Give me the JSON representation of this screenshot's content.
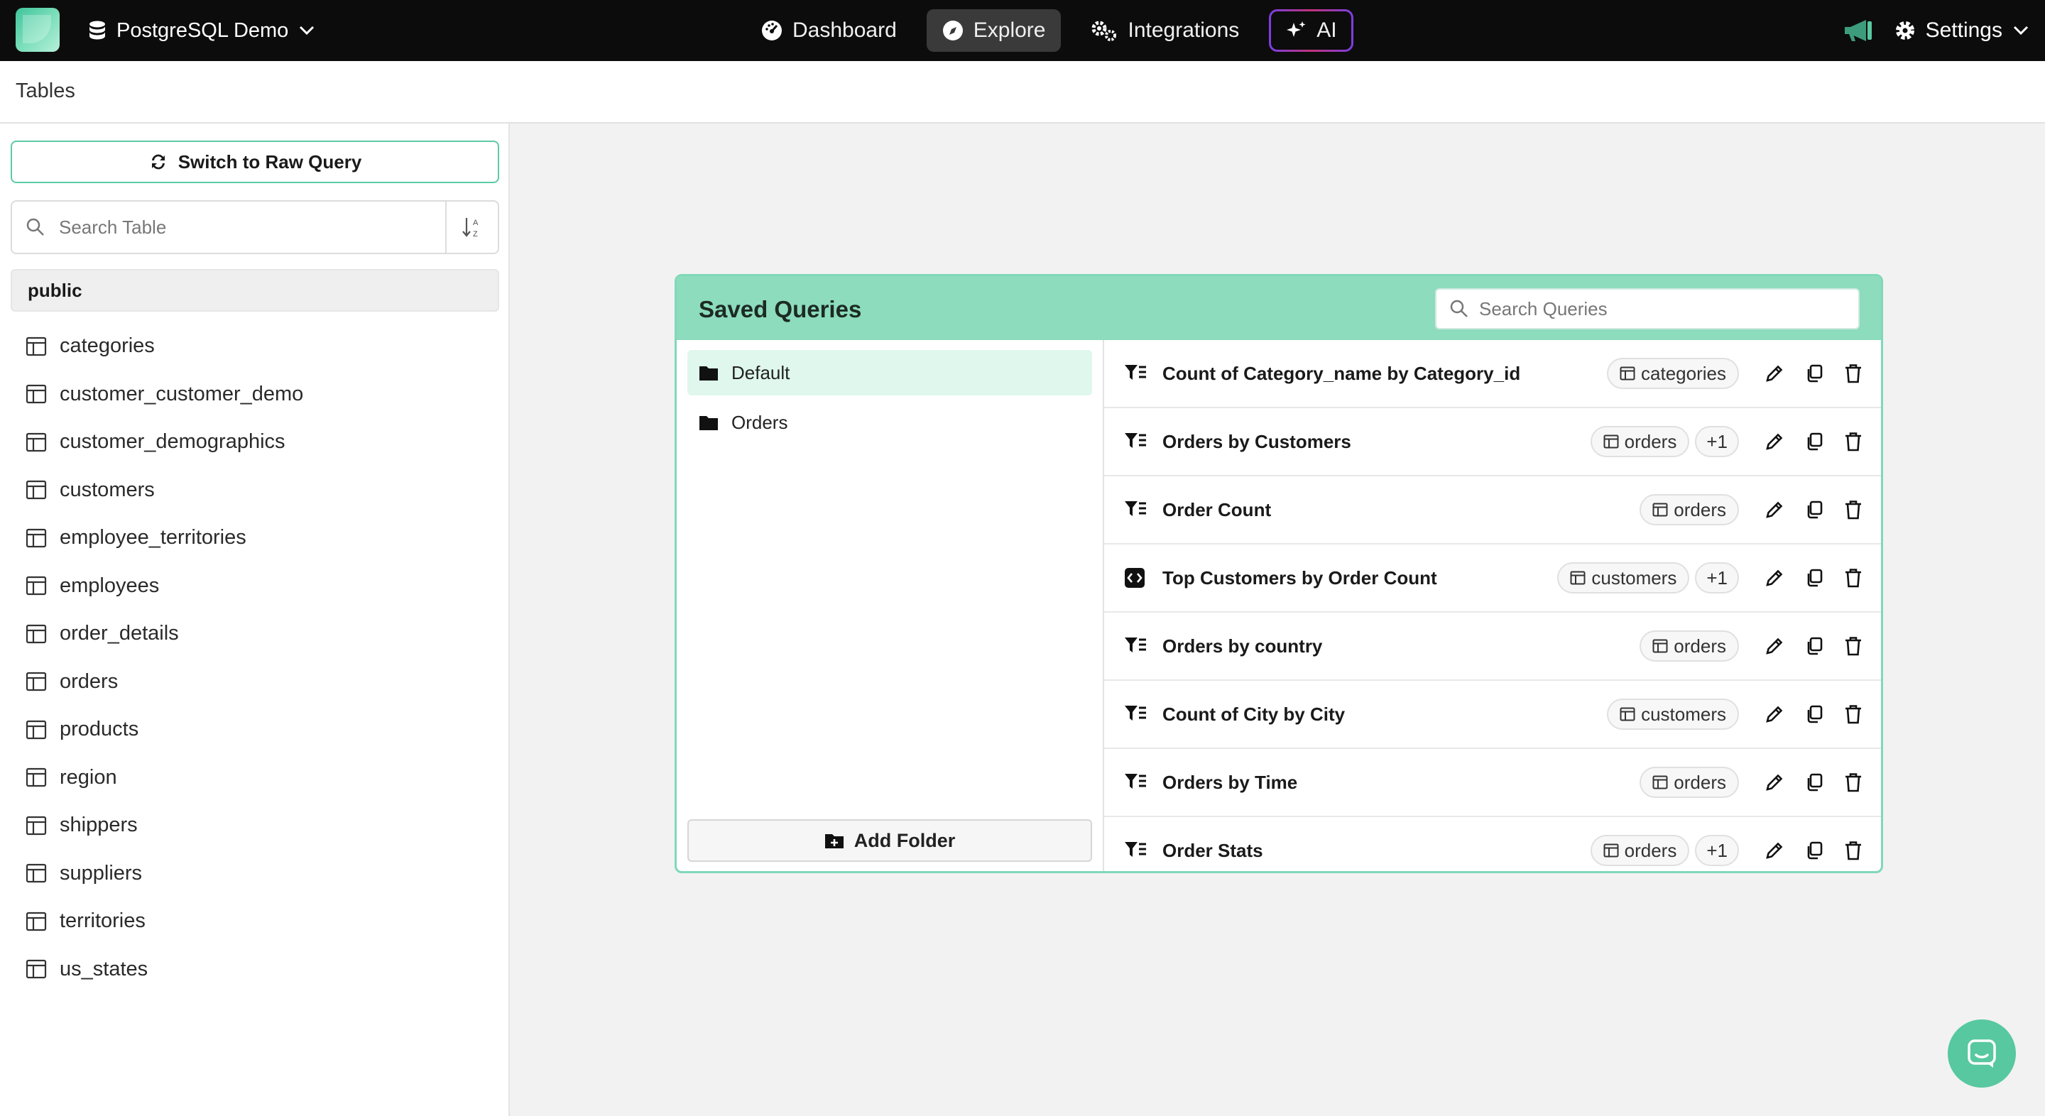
{
  "topbar": {
    "database_name": "PostgreSQL Demo",
    "nav": [
      {
        "label": "Dashboard",
        "icon": "gauge-icon",
        "active": false
      },
      {
        "label": "Explore",
        "icon": "compass-icon",
        "active": true
      },
      {
        "label": "Integrations",
        "icon": "gears-icon",
        "active": false
      },
      {
        "label": "AI",
        "icon": "sparkles-icon",
        "active": false
      }
    ],
    "settings_label": "Settings"
  },
  "subheader": {
    "title": "Tables"
  },
  "sidebar": {
    "raw_query_label": "Switch to Raw Query",
    "search_placeholder": "Search Table",
    "schema": "public",
    "tables": [
      "categories",
      "customer_customer_demo",
      "customer_demographics",
      "customers",
      "employee_territories",
      "employees",
      "order_details",
      "orders",
      "products",
      "region",
      "shippers",
      "suppliers",
      "territories",
      "us_states"
    ]
  },
  "saved_queries": {
    "title": "Saved Queries",
    "search_placeholder": "Search Queries",
    "folders": [
      {
        "name": "Default",
        "active": true
      },
      {
        "name": "Orders",
        "active": false
      }
    ],
    "add_folder_label": "Add Folder",
    "queries": [
      {
        "name": "Count of Category_name by Category_id",
        "icon": "filter-list-icon",
        "table": "categories",
        "extra": ""
      },
      {
        "name": "Orders by Customers",
        "icon": "filter-list-icon",
        "table": "orders",
        "extra": "+1"
      },
      {
        "name": "Order Count",
        "icon": "filter-list-icon",
        "table": "orders",
        "extra": ""
      },
      {
        "name": "Top Customers by Order Count",
        "icon": "code-icon",
        "table": "customers",
        "extra": "+1"
      },
      {
        "name": "Orders by country",
        "icon": "filter-list-icon",
        "table": "orders",
        "extra": ""
      },
      {
        "name": "Count of City by City",
        "icon": "filter-list-icon",
        "table": "customers",
        "extra": ""
      },
      {
        "name": "Orders by Time",
        "icon": "filter-list-icon",
        "table": "orders",
        "extra": ""
      },
      {
        "name": "Order Stats",
        "icon": "filter-list-icon",
        "table": "orders",
        "extra": "+1"
      }
    ]
  },
  "colors": {
    "accent": "#57c8a0",
    "header_green": "#8cdcbd",
    "topbar": "#0c0c0c"
  }
}
